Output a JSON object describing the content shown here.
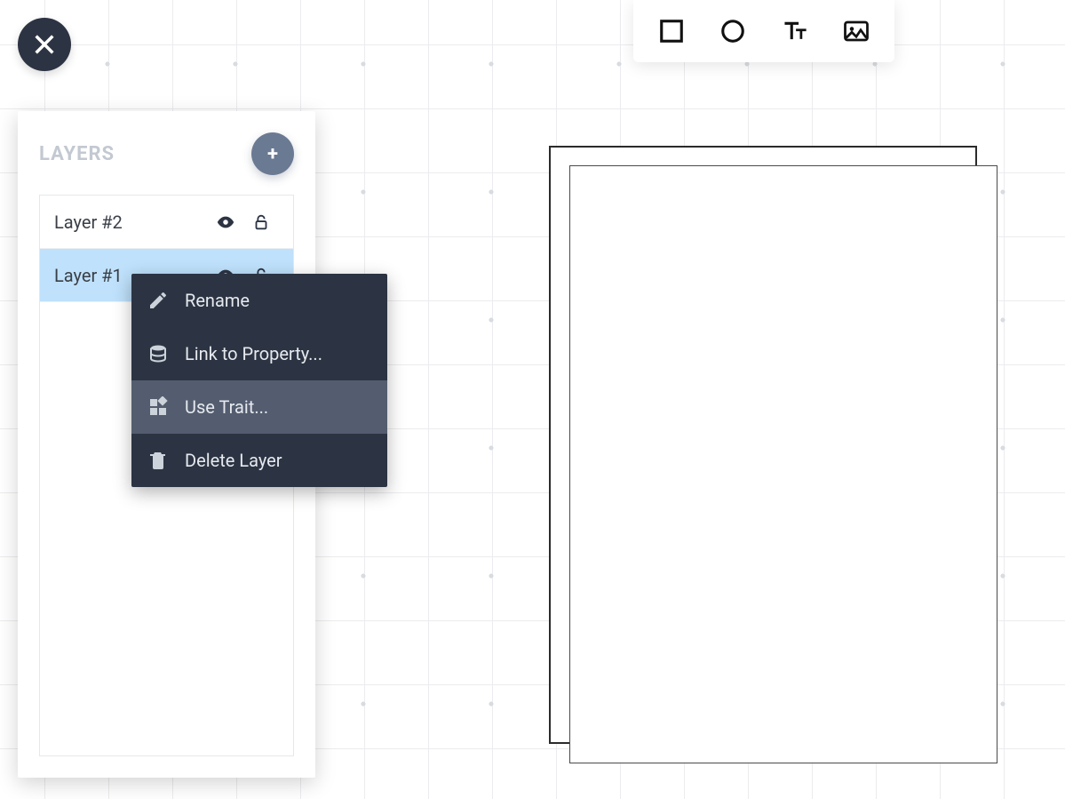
{
  "panel": {
    "title": "LAYERS",
    "add_label": "+"
  },
  "layers": [
    {
      "name": "Layer #2",
      "selected": false
    },
    {
      "name": "Layer #1",
      "selected": true
    }
  ],
  "context_menu": {
    "items": [
      {
        "label": "Rename",
        "icon": "pencil"
      },
      {
        "label": "Link to Property...",
        "icon": "database"
      },
      {
        "label": "Use Trait...",
        "icon": "widgets",
        "hover": true
      },
      {
        "label": "Delete Layer",
        "icon": "trash"
      }
    ]
  },
  "toolbar": {
    "tools": [
      {
        "name": "rectangle"
      },
      {
        "name": "circle"
      },
      {
        "name": "text"
      },
      {
        "name": "image"
      }
    ]
  }
}
